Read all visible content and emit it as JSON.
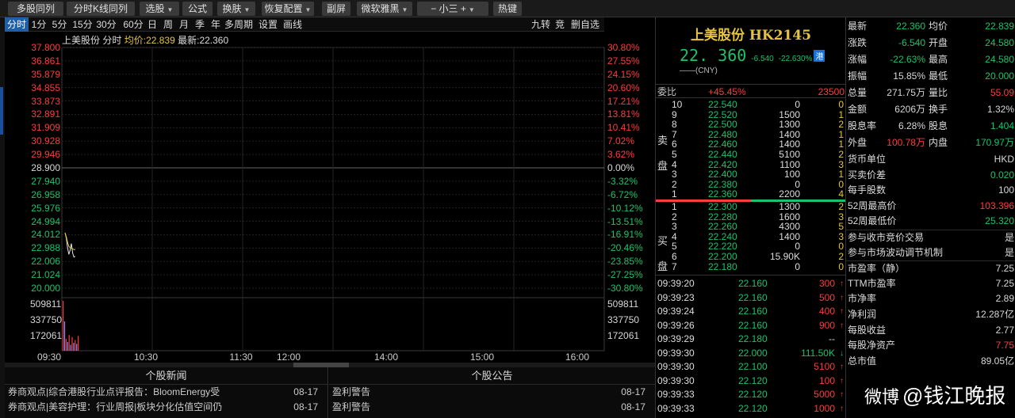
{
  "toolbar": {
    "buttons": [
      {
        "label": "多股同列",
        "dd": false
      },
      {
        "label": "分时K线同列",
        "dd": false
      },
      {
        "label": "选股",
        "dd": true
      },
      {
        "label": "公式",
        "dd": false
      },
      {
        "label": "换肤",
        "dd": true
      },
      {
        "label": "恢复配置",
        "dd": true
      },
      {
        "label": "副屏",
        "dd": false
      },
      {
        "label": "微软雅黑",
        "dd": true
      },
      {
        "label": "−  小三  +",
        "dd": true
      },
      {
        "label": "热键",
        "dd": false
      }
    ]
  },
  "periods": [
    "分时",
    "1分",
    "5分",
    "15分",
    "30分",
    "60分",
    "日",
    "周",
    "月",
    "季",
    "年",
    "多周期",
    "设置",
    "画线"
  ],
  "period_extras": [
    "九转",
    "竞",
    "删自选"
  ],
  "chart_info": {
    "name": "上美股份",
    "mode": "分时",
    "avg_label": "均价:",
    "avg": "22.839",
    "last_label": "最新:",
    "last": "22.360"
  },
  "chart_data": {
    "type": "line",
    "price_ticks": [
      "37.800",
      "36.861",
      "35.879",
      "34.855",
      "33.873",
      "32.891",
      "31.909",
      "30.928",
      "29.946",
      "28.900",
      "27.940",
      "26.958",
      "25.976",
      "24.994",
      "24.012",
      "22.988",
      "22.006",
      "21.024",
      "20.000"
    ],
    "pct_ticks": [
      "30.80%",
      "27.55%",
      "24.15%",
      "20.60%",
      "17.21%",
      "13.81%",
      "10.41%",
      "7.02%",
      "3.62%",
      "0.00%",
      "-3.32%",
      "-6.72%",
      "-10.12%",
      "-13.51%",
      "-16.91%",
      "-20.46%",
      "-23.85%",
      "-27.25%",
      "-30.80%"
    ],
    "prev_close": 28.9,
    "ylim": [
      20.0,
      37.8
    ],
    "volume_ticks": [
      "509811",
      "337750",
      "172061"
    ],
    "time_labels": [
      "09:30",
      "10:30",
      "11:30",
      "12:00",
      "14:00",
      "15:00",
      "16:00"
    ],
    "price_x": [
      0,
      1,
      2,
      3,
      4,
      5,
      6,
      7,
      8
    ],
    "price": [
      24.1,
      23.7,
      23.0,
      22.5,
      22.8,
      23.3,
      22.6,
      22.3,
      22.36
    ],
    "avg_line": [
      24.1,
      23.8,
      23.4,
      23.1,
      23.0,
      22.95,
      22.9,
      22.86,
      22.84
    ],
    "volume": [
      509811,
      300000,
      120000,
      90000,
      160000,
      60000,
      140000,
      80000,
      110000,
      70000,
      150000
    ]
  },
  "news": {
    "left_title": "个股新闻",
    "left_items": [
      {
        "text": "券商观点|综合港股行业点评报告：BloomEnergy受",
        "date": "08-17"
      },
      {
        "text": "券商观点|美容护理：行业周报|板块分化估值空间仍",
        "date": "08-17"
      }
    ],
    "right_title": "个股公告",
    "right_items": [
      {
        "text": "盈利警告",
        "date": "08-17"
      },
      {
        "text": "盈利警告",
        "date": "08-17"
      }
    ]
  },
  "quote": {
    "title": "上美股份 HK2145",
    "price": "22. 360",
    "change": "-6.540",
    "change_pct": "-22.630%",
    "badge": "港",
    "currency": "——(CNY)",
    "wb_label": "委比",
    "wb_value": "+45.45%",
    "wb_diff": "23500"
  },
  "order_book": {
    "sell_label_1": "卖",
    "sell_label_2": "盘",
    "buy_label_1": "买",
    "buy_label_2": "盘",
    "sell": [
      {
        "lvl": "10",
        "price": "22.540",
        "vol": "0",
        "n": "0"
      },
      {
        "lvl": "9",
        "price": "22.520",
        "vol": "1500",
        "n": "1"
      },
      {
        "lvl": "8",
        "price": "22.500",
        "vol": "1300",
        "n": "2"
      },
      {
        "lvl": "7",
        "price": "22.480",
        "vol": "1400",
        "n": "1"
      },
      {
        "lvl": "6",
        "price": "22.460",
        "vol": "1400",
        "n": "1"
      },
      {
        "lvl": "5",
        "price": "22.440",
        "vol": "5100",
        "n": "2"
      },
      {
        "lvl": "4",
        "price": "22.420",
        "vol": "1100",
        "n": "3"
      },
      {
        "lvl": "3",
        "price": "22.400",
        "vol": "100",
        "n": "1"
      },
      {
        "lvl": "2",
        "price": "22.380",
        "vol": "0",
        "n": "0"
      },
      {
        "lvl": "1",
        "price": "22.360",
        "vol": "2200",
        "n": "4"
      }
    ],
    "buy": [
      {
        "lvl": "1",
        "price": "22.300",
        "vol": "1300",
        "n": "2"
      },
      {
        "lvl": "2",
        "price": "22.280",
        "vol": "1600",
        "n": "3"
      },
      {
        "lvl": "3",
        "price": "22.260",
        "vol": "4300",
        "n": "5"
      },
      {
        "lvl": "4",
        "price": "22.240",
        "vol": "1400",
        "n": "3"
      },
      {
        "lvl": "5",
        "price": "22.220",
        "vol": "0",
        "n": "0"
      },
      {
        "lvl": "6",
        "price": "22.200",
        "vol": "15.90K",
        "n": "2"
      },
      {
        "lvl": "7",
        "price": "22.180",
        "vol": "0",
        "n": "0"
      }
    ]
  },
  "ticks": [
    {
      "time": "09:39:20",
      "price": "22.160",
      "vol": "300",
      "dir": "up"
    },
    {
      "time": "09:39:23",
      "price": "22.160",
      "vol": "500",
      "dir": "up"
    },
    {
      "time": "09:39:24",
      "price": "22.160",
      "vol": "400",
      "dir": "up"
    },
    {
      "time": "09:39:26",
      "price": "22.160",
      "vol": "900",
      "dir": "up"
    },
    {
      "time": "09:39:29",
      "price": "22.180",
      "vol": "--",
      "dir": "none"
    },
    {
      "time": "09:39:30",
      "price": "22.000",
      "vol": "111.50K",
      "dir": "down"
    },
    {
      "time": "09:39:30",
      "price": "22.100",
      "vol": "5100",
      "dir": "up"
    },
    {
      "time": "09:39:30",
      "price": "22.120",
      "vol": "100",
      "dir": "up"
    },
    {
      "time": "09:39:33",
      "price": "22.120",
      "vol": "5000",
      "dir": "up"
    },
    {
      "time": "09:39:33",
      "price": "22.120",
      "vol": "1000",
      "dir": "up"
    }
  ],
  "stats_pairs": [
    {
      "l1": "最新",
      "v1": "22.360",
      "c1": "dn",
      "l2": "均价",
      "v2": "22.839",
      "c2": "dn"
    },
    {
      "l1": "涨跌",
      "v1": "-6.540",
      "c1": "dn",
      "l2": "开盘",
      "v2": "24.580",
      "c2": "dn"
    },
    {
      "l1": "涨幅",
      "v1": "-22.63%",
      "c1": "dn",
      "l2": "最高",
      "v2": "24.580",
      "c2": "dn"
    },
    {
      "l1": "振幅",
      "v1": "15.85%",
      "c1": "fl",
      "l2": "最低",
      "v2": "20.000",
      "c2": "dn"
    },
    {
      "l1": "总量",
      "v1": "271.75万",
      "c1": "fl",
      "l2": "量比",
      "v2": "55.09",
      "c2": "up"
    },
    {
      "l1": "金额",
      "v1": "6206万",
      "c1": "fl",
      "l2": "换手",
      "v2": "1.32%",
      "c2": "fl"
    },
    {
      "l1": "股息率",
      "v1": "6.28%",
      "c1": "fl",
      "l2": "股息",
      "v2": "1.404",
      "c2": "dn"
    },
    {
      "l1": "外盘",
      "v1": "100.78万",
      "c1": "up",
      "l2": "内盘",
      "v2": "170.97万",
      "c2": "dn"
    }
  ],
  "stats_rows": [
    {
      "label": "货币单位",
      "value": "HKD",
      "c": "fl"
    },
    {
      "label": "买卖价差",
      "value": "0.020",
      "c": "dn"
    },
    {
      "label": "每手股数",
      "value": "100",
      "c": "fl"
    },
    {
      "label": "52周最高价",
      "value": "103.396",
      "c": "up"
    },
    {
      "label": "52周最低价",
      "value": "25.320",
      "c": "dn"
    },
    {
      "label": "参与收市竞价交易",
      "value": "是",
      "c": "fl"
    },
    {
      "label": "参与市场波动调节机制",
      "value": "是",
      "c": "fl"
    },
    {
      "label": "市盈率（静）",
      "value": "7.25",
      "c": "fl"
    },
    {
      "label": "TTM市盈率",
      "value": "7.25",
      "c": "fl"
    },
    {
      "label": "市净率",
      "value": "2.89",
      "c": "fl"
    },
    {
      "label": "净利润",
      "value": "12.287亿",
      "c": "fl"
    },
    {
      "label": "每股收益",
      "value": "2.77",
      "c": "fl"
    },
    {
      "label": "每股净资产",
      "value": "7.75",
      "c": "up"
    },
    {
      "label": "总市值",
      "value": "89.05亿",
      "c": "fl"
    }
  ],
  "watermark": {
    "logo": "微博",
    "text": "@钱江晚报"
  }
}
